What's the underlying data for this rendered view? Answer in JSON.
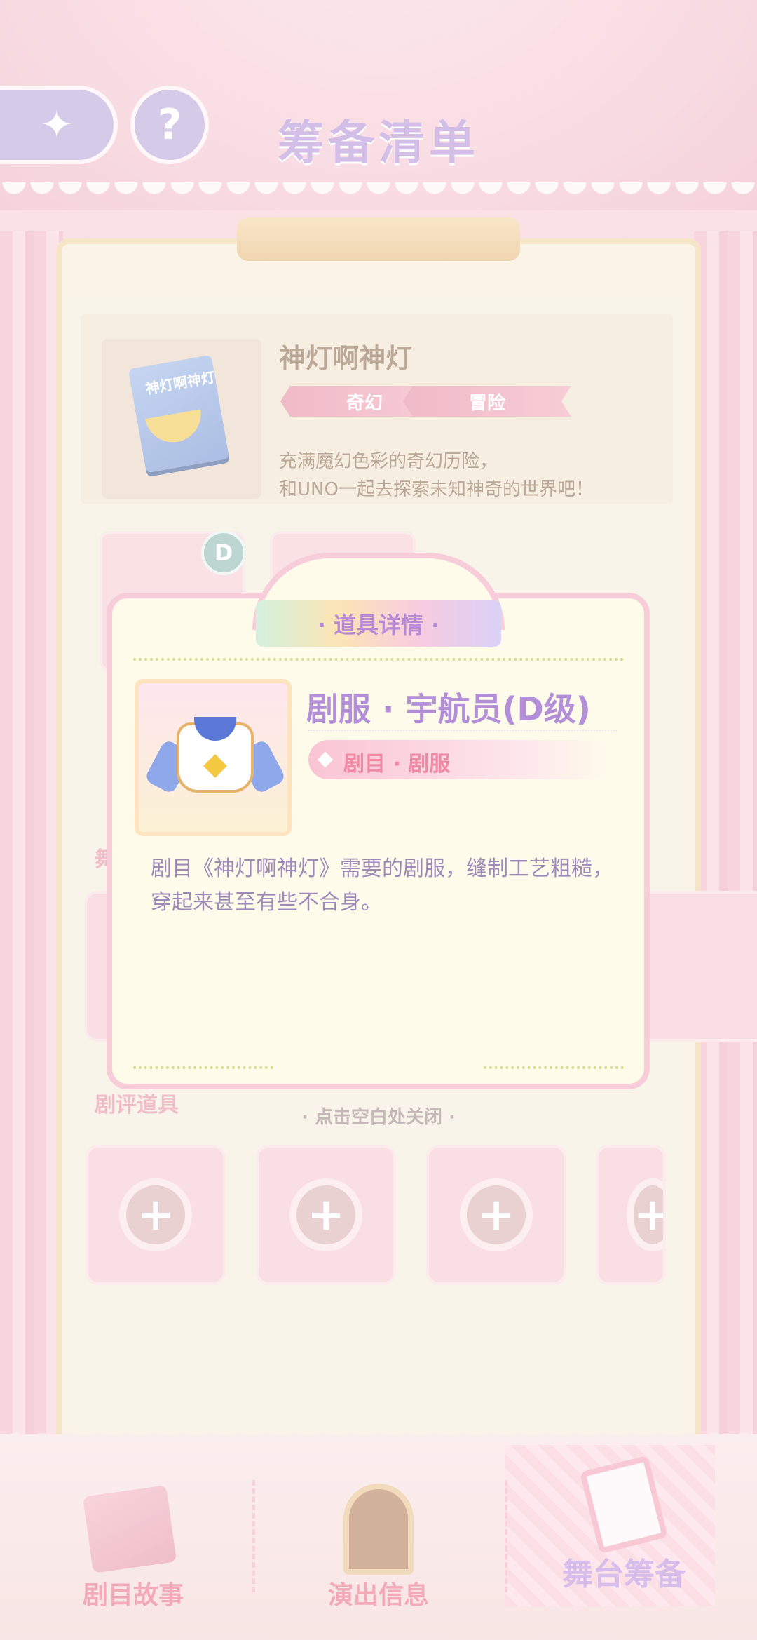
{
  "header": {
    "title": "筹备清单",
    "back_icon": "compass-arrow-icon",
    "help_label": "?"
  },
  "play": {
    "cover_text": "神灯啊神灯",
    "title": "神灯啊神灯",
    "tags": [
      "奇幻",
      "冒险"
    ],
    "description_line1": "充满魔幻色彩的奇幻历险，",
    "description_line2": "和UNO一起去探索未知神奇的世界吧！"
  },
  "slots": {
    "grade_badge": "D"
  },
  "sections": {
    "stage_props_partial": "舞",
    "review_props": "剧评道具"
  },
  "modal": {
    "header": "· 道具详情 ·",
    "item_name": "剧服 · 宇航员(D级)",
    "item_category": "剧目 · 剧服",
    "item_description": "剧目《神灯啊神灯》需要的剧服，缝制工艺粗糙，穿起来甚至有些不合身。",
    "close_hint": "· 点击空白处关闭 ·"
  },
  "bottom_nav": {
    "items": [
      {
        "label": "剧目故事",
        "icon": "storybook-icon"
      },
      {
        "label": "演出信息",
        "icon": "notice-board-icon"
      },
      {
        "label": "舞台筹备",
        "icon": "clipboard-icon",
        "active": true
      }
    ]
  }
}
